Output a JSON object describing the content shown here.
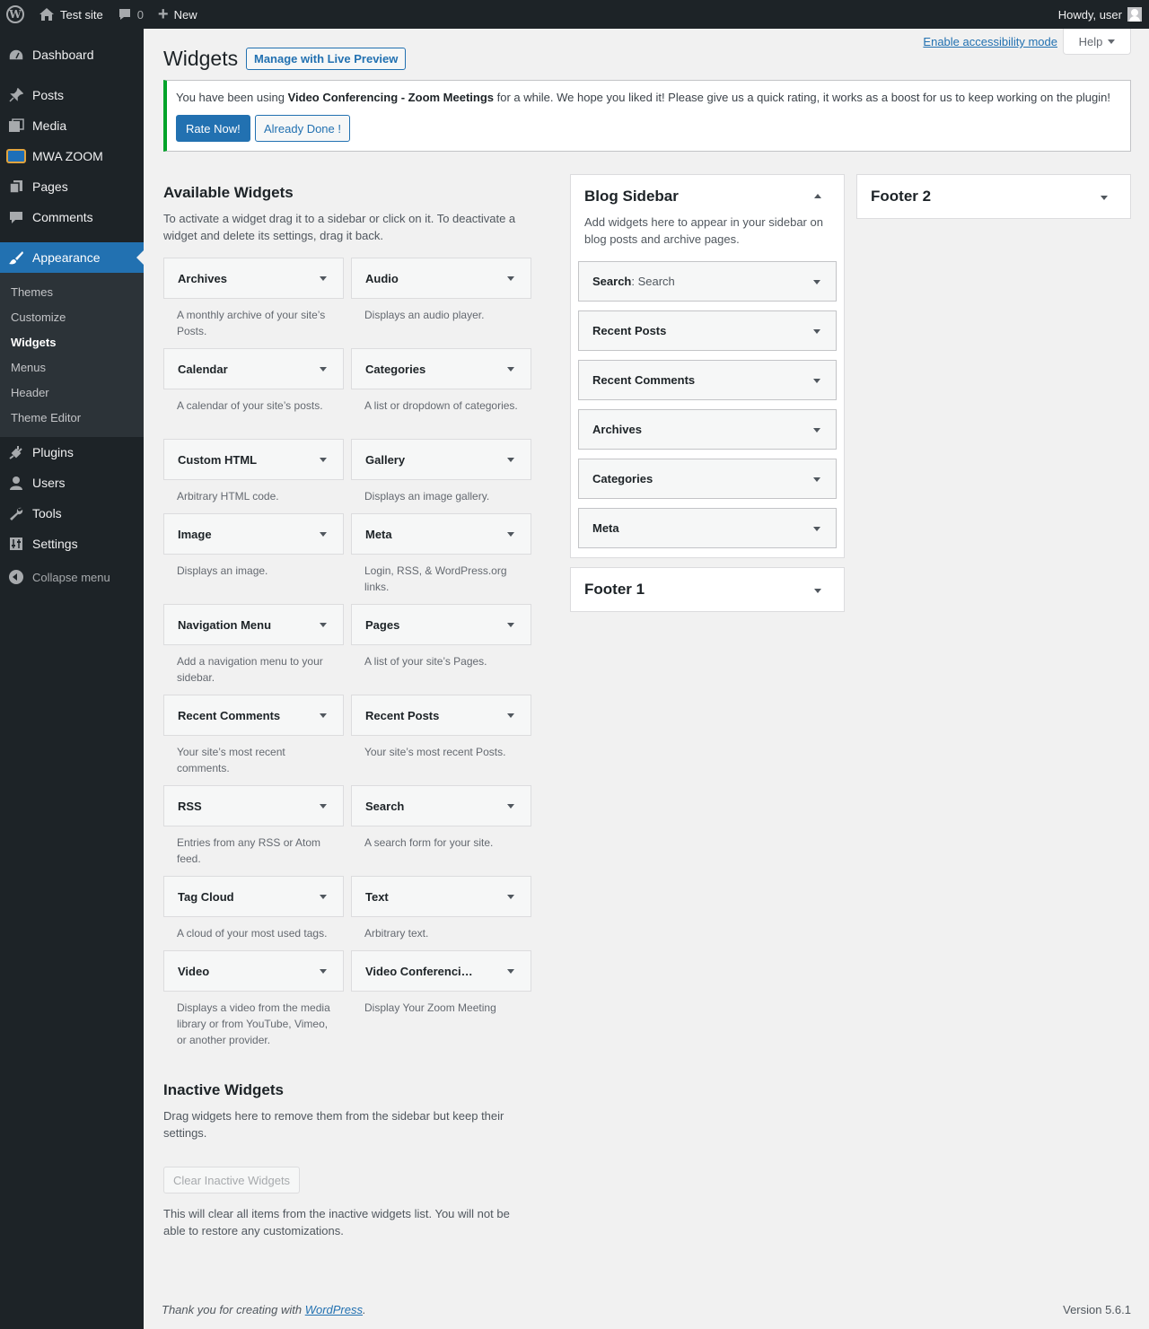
{
  "adminbar": {
    "site_name": "Test site",
    "comments_count": "0",
    "new_label": "New",
    "howdy": "Howdy, user"
  },
  "menu": {
    "dashboard": "Dashboard",
    "posts": "Posts",
    "media": "Media",
    "mwa_zoom": "MWA ZOOM",
    "pages": "Pages",
    "comments": "Comments",
    "appearance": "Appearance",
    "plugins": "Plugins",
    "users": "Users",
    "tools": "Tools",
    "settings": "Settings",
    "collapse": "Collapse menu",
    "submenu": [
      "Themes",
      "Customize",
      "Widgets",
      "Menus",
      "Header",
      "Theme Editor"
    ]
  },
  "screen_meta": {
    "accessibility": "Enable accessibility mode",
    "help": "Help"
  },
  "header": {
    "title": "Widgets",
    "live_preview": "Manage with Live Preview"
  },
  "notice": {
    "text_before": "You have been using ",
    "plugin": "Video Conferencing - Zoom Meetings",
    "text_after": " for a while. We hope you liked it! Please give us a quick rating, it works as a boost for us to keep working on the plugin!",
    "rate_now": "Rate Now!",
    "already_done": "Already Done !"
  },
  "available": {
    "title": "Available Widgets",
    "description": "To activate a widget drag it to a sidebar or click on it. To deactivate a widget and delete its settings, drag it back.",
    "widgets": [
      {
        "title": "Archives",
        "desc": "A monthly archive of your site’s Posts."
      },
      {
        "title": "Audio",
        "desc": "Displays an audio player."
      },
      {
        "title": "Calendar",
        "desc": "A calendar of your site’s posts."
      },
      {
        "title": "Categories",
        "desc": "A list or dropdown of categories."
      },
      {
        "title": "Custom HTML",
        "desc": "Arbitrary HTML code."
      },
      {
        "title": "Gallery",
        "desc": "Displays an image gallery."
      },
      {
        "title": "Image",
        "desc": "Displays an image."
      },
      {
        "title": "Meta",
        "desc": "Login, RSS, & WordPress.org links."
      },
      {
        "title": "Navigation Menu",
        "desc": "Add a navigation menu to your sidebar."
      },
      {
        "title": "Pages",
        "desc": "A list of your site’s Pages."
      },
      {
        "title": "Recent Comments",
        "desc": "Your site’s most recent comments."
      },
      {
        "title": "Recent Posts",
        "desc": "Your site’s most recent Posts."
      },
      {
        "title": "RSS",
        "desc": "Entries from any RSS or Atom feed."
      },
      {
        "title": "Search",
        "desc": "A search form for your site."
      },
      {
        "title": "Tag Cloud",
        "desc": "A cloud of your most used tags."
      },
      {
        "title": "Text",
        "desc": "Arbitrary text."
      },
      {
        "title": "Video",
        "desc": "Displays a video from the media library or from YouTube, Vimeo, or another provider."
      },
      {
        "title": "Video Conferenci…",
        "desc": "Display Your Zoom Meeting"
      }
    ]
  },
  "blog_sidebar": {
    "title": "Blog Sidebar",
    "description": "Add widgets here to appear in your sidebar on blog posts and archive pages.",
    "widgets": [
      {
        "title": "Search",
        "instance": ": Search"
      },
      {
        "title": "Recent Posts",
        "instance": ""
      },
      {
        "title": "Recent Comments",
        "instance": ""
      },
      {
        "title": "Archives",
        "instance": ""
      },
      {
        "title": "Categories",
        "instance": ""
      },
      {
        "title": "Meta",
        "instance": ""
      }
    ]
  },
  "footer1": {
    "title": "Footer 1"
  },
  "footer2": {
    "title": "Footer 2"
  },
  "inactive": {
    "title": "Inactive Widgets",
    "description": "Drag widgets here to remove them from the sidebar but keep their settings.",
    "clear_button": "Clear Inactive Widgets",
    "note": "This will clear all items from the inactive widgets list. You will not be able to restore any customizations."
  },
  "footer": {
    "thanks_before": "Thank you for creating with ",
    "wordpress": "WordPress",
    "thanks_after": ".",
    "version": "Version 5.6.1"
  }
}
